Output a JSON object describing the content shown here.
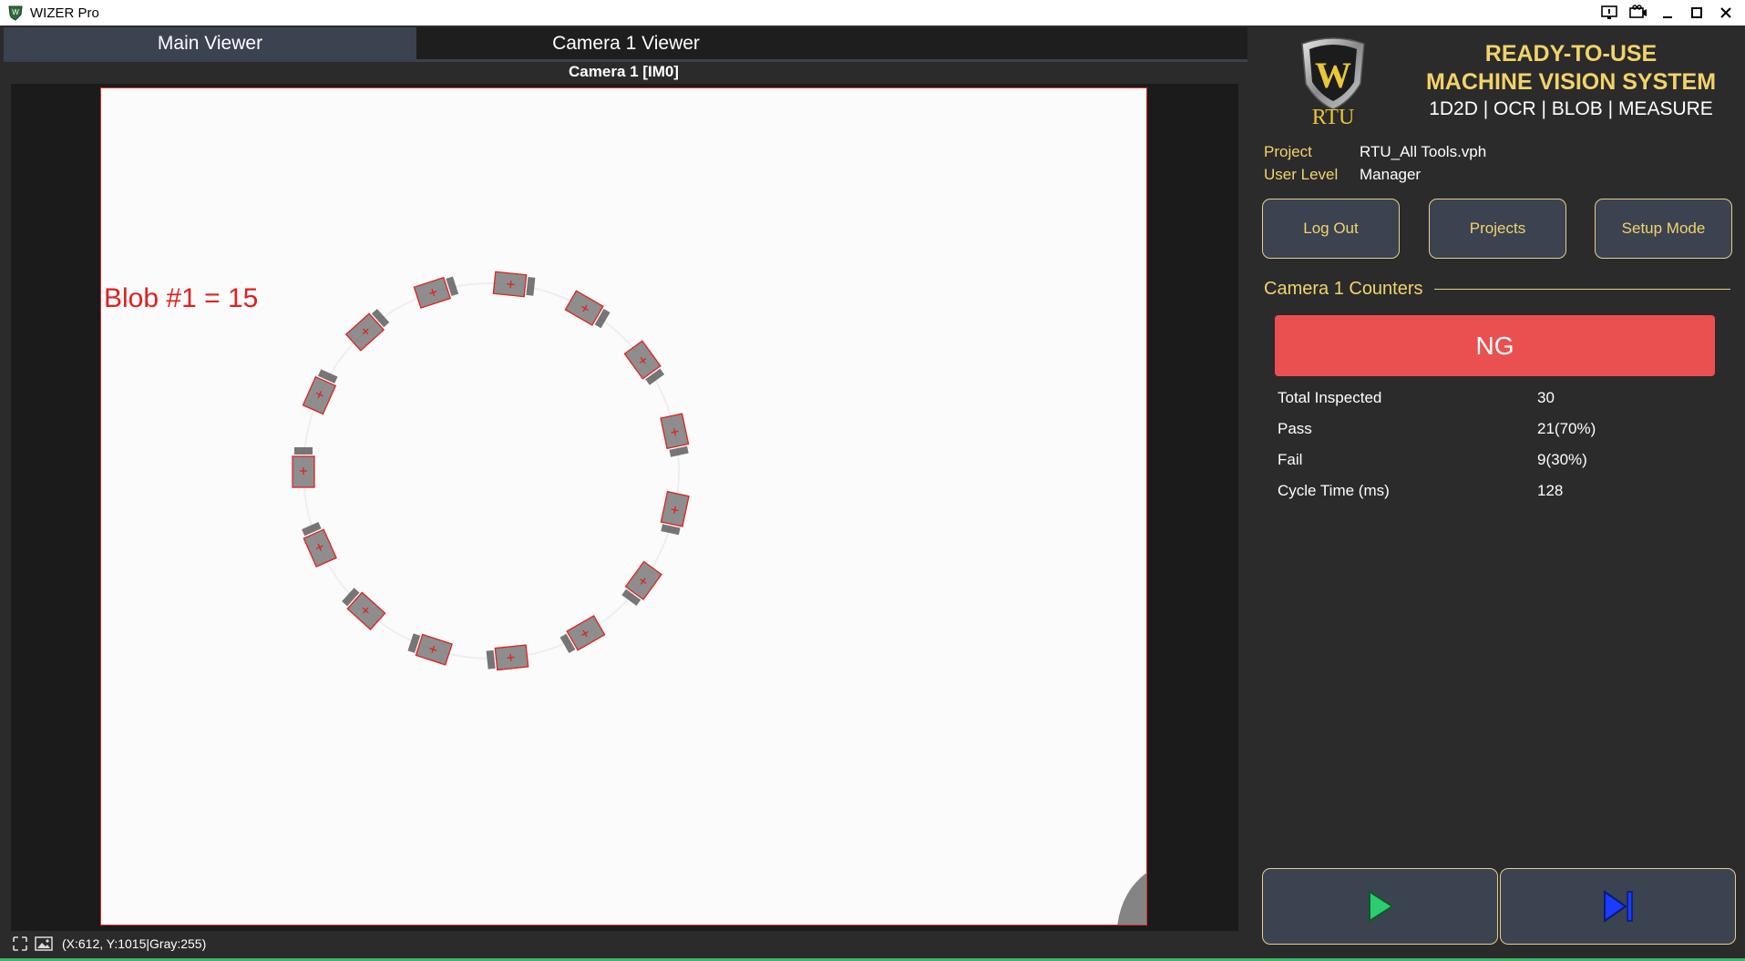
{
  "window": {
    "title": "WIZER Pro",
    "controls": [
      "monitor-icon",
      "projector-icon",
      "minimize-icon",
      "maximize-icon",
      "close-icon"
    ]
  },
  "tabs": [
    {
      "label": "Main Viewer",
      "active": true
    },
    {
      "label": "Camera 1 Viewer",
      "active": false
    }
  ],
  "viewer": {
    "camera_title": "Camera 1  [IM0]",
    "blob_label": "Blob #1 = 15",
    "status_coords": "(X:612, Y:1015|Gray:255)"
  },
  "header": {
    "logo_text": "RTU",
    "logo_letter": "W",
    "line1": "READY-TO-USE",
    "line2": "MACHINE VISION SYSTEM",
    "subtitle": "1D2D | OCR | BLOB | MEASURE"
  },
  "info": {
    "project_key": "Project",
    "project_value": "RTU_All Tools.vph",
    "user_key": "User Level",
    "user_value": "Manager"
  },
  "buttons": {
    "logout": "Log Out",
    "projects": "Projects",
    "setup": "Setup Mode"
  },
  "counters": {
    "title": "Camera 1 Counters",
    "result": "NG",
    "stats": [
      {
        "label": "Total Inspected",
        "value": "30"
      },
      {
        "label": "Pass",
        "value": "21(70%)"
      },
      {
        "label": "Fail",
        "value": "9(30%)"
      },
      {
        "label": "Cycle Time (ms)",
        "value": "128"
      }
    ]
  },
  "colors": {
    "accent_gold": "#f2d36b",
    "ng_red": "#eb5050",
    "button_bg": "#3b4250",
    "play_green": "#2ecc71",
    "step_blue": "#1a3cff"
  }
}
